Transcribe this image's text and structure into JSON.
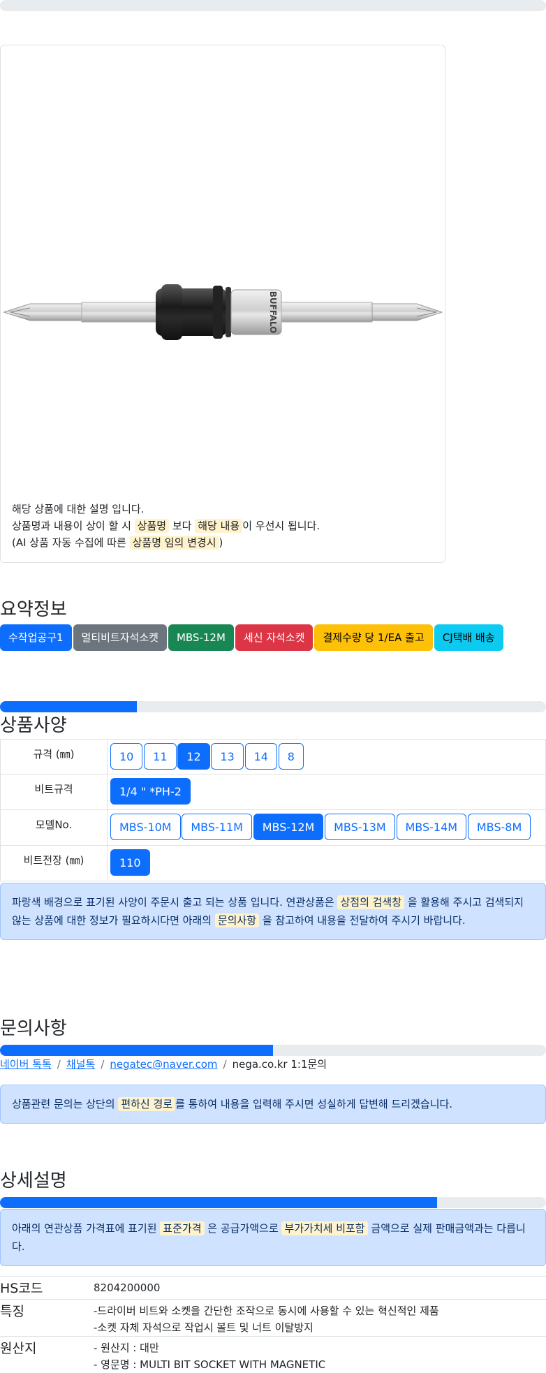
{
  "notice": {
    "line1": "해당 상품에 대한 설명 입니다.",
    "line2_pre": "상품명과 내용이 상이 할 시",
    "line2_hl1": "상품명",
    "line2_mid": "보다",
    "line2_hl2": "해당 내용",
    "line2_post": "이 우선시 됩니다.",
    "line3_pre": "(AI 상품 자동 수집에 따른",
    "line3_hl": "상품명 임의 변경시",
    "line3_post": ")"
  },
  "summary": {
    "title": "요약정보",
    "badges": [
      "수작업공구1",
      "멀티비트자석소켓",
      "MBS-12M",
      "세신 자석소켓",
      "결제수량 당 1/EA 출고",
      "CJ택배 배송"
    ]
  },
  "spec": {
    "progress": 0.25,
    "title": "상품사양",
    "rows": [
      {
        "label": "규격 (㎜)",
        "options": [
          "10",
          "11",
          "12",
          "13",
          "14",
          "8"
        ],
        "selected": "12"
      },
      {
        "label": "비트규격",
        "options": [
          "1/4 \" *PH-2"
        ],
        "selected": "1/4 \" *PH-2"
      },
      {
        "label": "모델No.",
        "options": [
          "MBS-10M",
          "MBS-11M",
          "MBS-12M",
          "MBS-13M",
          "MBS-14M",
          "MBS-8M"
        ],
        "selected": "MBS-12M"
      },
      {
        "label": "비트전장 (㎜)",
        "options": [
          "110"
        ],
        "selected": "110"
      }
    ],
    "alert_pre": "파랑색 배경으로 표기된 사양이 주문시 출고 되는 상품 입니다. 연관상품은",
    "alert_hl1": "상점의 검색창",
    "alert_mid": "을 활용해 주시고 검색되지 않는 상품에 대한 정보가 필요하시다면 아래의",
    "alert_hl2": "문의사항",
    "alert_post": "을 참고하여 내용을 전달하여 주시기 바랍니다."
  },
  "inquiry": {
    "title": "문의사항",
    "progress": 0.5,
    "links": [
      "네이버 톡톡",
      "채널톡",
      "negatec@naver.com"
    ],
    "plain": "nega.co.kr 1:1문의",
    "alert_pre": "상품관련 문의는 상단의",
    "alert_hl": "편하신 경로",
    "alert_post": "를 통하여 내용을 입력해 주시면 성실하게 답변해 드리겠습니다."
  },
  "detail": {
    "title": "상세설명",
    "progress": 0.8,
    "alert_pre": "아래의 연관상품 가격표에 표기된",
    "alert_hl1": "표준가격",
    "alert_mid": "은 공급가액으로",
    "alert_hl2": "부가가치세 비포함",
    "alert_post": "금액으로 실제 판매금액과는 다릅니다.",
    "rows": [
      {
        "key": "HS코드",
        "lines": [
          "8204200000"
        ]
      },
      {
        "key": "특징",
        "lines": [
          "-드라이버 비트와 소켓을 간단한 조작으로 동시에 사용할 수 있는 혁신적인 제품",
          "-소켓 자체 자석으로 작업시 볼트 및 너트 이탈방지"
        ]
      },
      {
        "key": "원산지",
        "lines": [
          "- 원산지 : 대만",
          "- 영문명 : MULTI BIT SOCKET WITH MAGNETIC"
        ]
      }
    ]
  },
  "product_image": {
    "brand_text": "BUFFALO"
  },
  "colors": {
    "primary": "#0d6efd",
    "highlight": "#fff3cd",
    "alert_bg": "#cfe2ff"
  }
}
